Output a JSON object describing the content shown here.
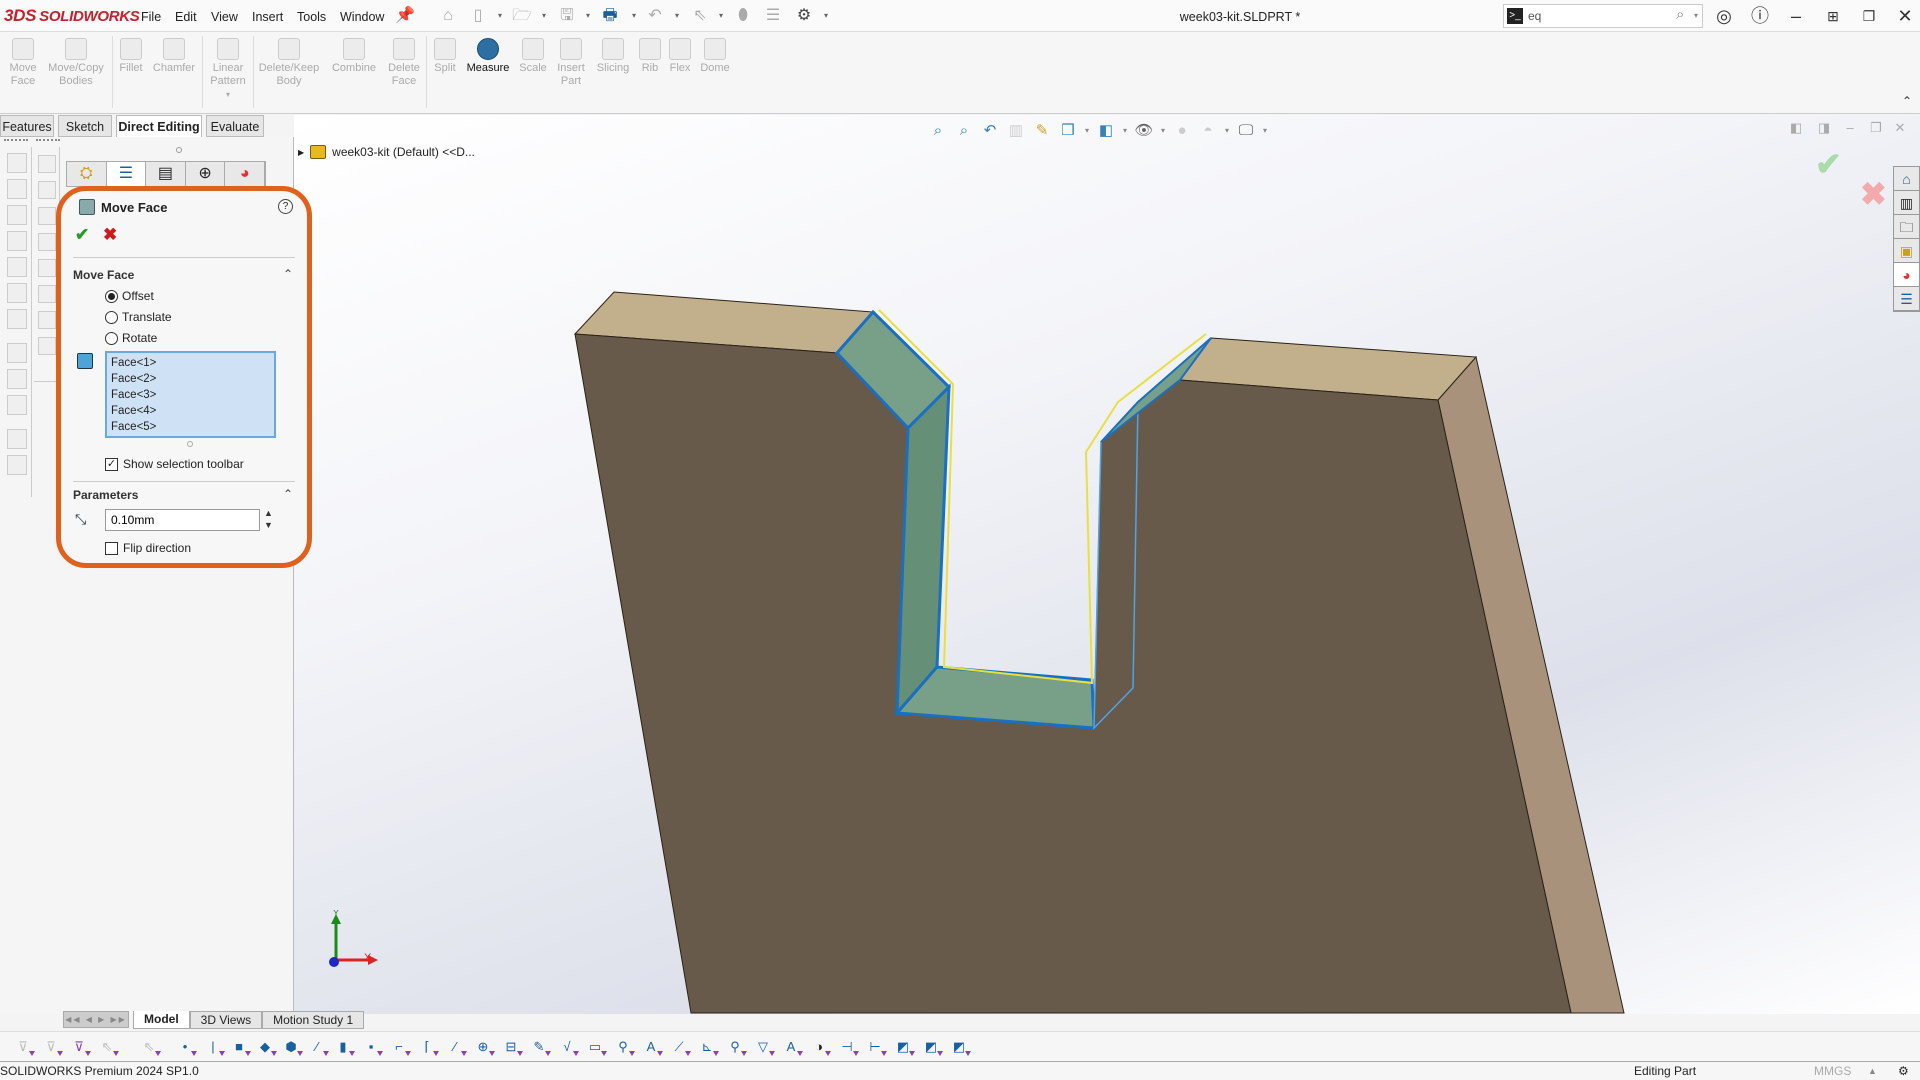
{
  "app": {
    "logo": "SOLIDWORKS",
    "logo_mark": "3DS",
    "document_title": "week03-kit.SLDPRT *"
  },
  "menu": [
    "File",
    "Edit",
    "View",
    "Insert",
    "Tools",
    "Window"
  ],
  "quick_access": [
    "home-icon",
    "new-icon",
    "open-icon",
    "save-icon",
    "print-icon",
    "undo-icon",
    "select-icon",
    "rebuild-icon",
    "file-properties-icon",
    "options-icon"
  ],
  "search": {
    "value": "eq",
    "placeholder": ""
  },
  "window_controls": [
    "account-icon",
    "help-icon",
    "minimize",
    "tile",
    "restore",
    "close"
  ],
  "command_manager": {
    "tools": [
      {
        "label": "Move\nFace",
        "enabled": false
      },
      {
        "label": "Move/Copy\nBodies",
        "enabled": false
      },
      {
        "label": "Fillet",
        "enabled": false
      },
      {
        "label": "Chamfer",
        "enabled": false
      },
      {
        "label": "Linear\nPattern",
        "enabled": false
      },
      {
        "label": "Delete/Keep\nBody",
        "enabled": false
      },
      {
        "label": "Combine",
        "enabled": false
      },
      {
        "label": "Delete\nFace",
        "enabled": false
      },
      {
        "label": "Split",
        "enabled": false
      },
      {
        "label": "Measure",
        "enabled": true
      },
      {
        "label": "Scale",
        "enabled": false
      },
      {
        "label": "Insert\nPart",
        "enabled": false
      },
      {
        "label": "Slicing",
        "enabled": false
      },
      {
        "label": "Rib",
        "enabled": false
      },
      {
        "label": "Flex",
        "enabled": false
      },
      {
        "label": "Dome",
        "enabled": false
      }
    ],
    "tabs": [
      {
        "label": "Features",
        "active": false
      },
      {
        "label": "Sketch",
        "active": false
      },
      {
        "label": "Direct Editing",
        "active": true
      },
      {
        "label": "Evaluate",
        "active": false
      }
    ]
  },
  "property_manager": {
    "title": "Move Face",
    "help": "?",
    "ok": "✔",
    "cancel": "✖",
    "group_move_face": "Move Face",
    "options": [
      {
        "label": "Offset",
        "selected": true
      },
      {
        "label": "Translate",
        "selected": false
      },
      {
        "label": "Rotate",
        "selected": false
      }
    ],
    "faces": [
      "Face<1>",
      "Face<2>",
      "Face<3>",
      "Face<4>",
      "Face<5>"
    ],
    "show_selection_toolbar": {
      "label": "Show selection toolbar",
      "checked": true
    },
    "group_parameters": "Parameters",
    "distance": "0.10mm",
    "flip_direction": {
      "label": "Flip direction",
      "checked": false
    }
  },
  "feature_tree": {
    "root": "week03-kit (Default) <<D..."
  },
  "bottom_tabs": [
    {
      "label": "Model",
      "active": true
    },
    {
      "label": "3D Views",
      "active": false
    },
    {
      "label": "Motion Study 1",
      "active": false
    }
  ],
  "status": {
    "product": "SOLIDWORKS Premium 2024 SP1.0",
    "mode": "Editing Part",
    "units": "MMGS"
  },
  "triad": {
    "x": "X",
    "y": "Y"
  },
  "colors": {
    "highlight": "#e0611c",
    "body_front": "#675a4a",
    "body_top": "#c2b08c",
    "body_side": "#a8927c",
    "selection_blue": "#1a6fc0",
    "selection_yellow": "#e8e040",
    "selected_face": "#78a088"
  }
}
